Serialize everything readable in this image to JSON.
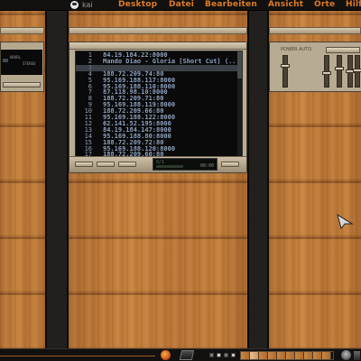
{
  "topbar": {
    "user_name": "kai",
    "menu": [
      "Desktop",
      "Datei",
      "Bearbeiten",
      "Ansicht",
      "Orte",
      "Hilfe"
    ]
  },
  "playlist": {
    "entries": [
      {
        "num": "1",
        "text": "84.19.184.22:8000"
      },
      {
        "num": "2",
        "text": "Mando Diao - Gloria [Short Cut] (..."
      },
      {
        "num": "3",
        "text": ""
      },
      {
        "num": "4",
        "text": "188.72.209.74:80"
      },
      {
        "num": "5",
        "text": "95.169.188.117:8000"
      },
      {
        "num": "6",
        "text": "95.169.188.110:8000"
      },
      {
        "num": "7",
        "text": "87.118.98.10:8000"
      },
      {
        "num": "8",
        "text": "188.72.209.71:80"
      },
      {
        "num": "9",
        "text": "95.169.188.119:8000"
      },
      {
        "num": "10",
        "text": "188.72.209.66:80"
      },
      {
        "num": "11",
        "text": "95.169.188.122:8000"
      },
      {
        "num": "12",
        "text": "62.141.52.195:8000"
      },
      {
        "num": "13",
        "text": "84.19.184.147:8000"
      },
      {
        "num": "14",
        "text": "95.169.188.80:8000"
      },
      {
        "num": "15",
        "text": "188.72.209.72:80"
      },
      {
        "num": "16",
        "text": "95.169.188.120:8000"
      },
      {
        "num": "17",
        "text": "188.72.209.60:80"
      }
    ],
    "selected_index": 2,
    "info_text": "0/1",
    "time_text": "00:00"
  },
  "mini_player": {
    "lines": [
      "HRVRL",
      "STEREO"
    ]
  },
  "equalizer": {
    "label": "POWER AUTO",
    "levels": [
      0.3,
      0.55,
      0.4,
      0.5,
      0.45
    ]
  },
  "colors": {
    "menu_text": "#e07c26",
    "playlist_text": "#8da2bf",
    "playlist_bg": "#0a0a0a",
    "wood": "#c3803c"
  },
  "icons": [
    "user-icon",
    "firefox-icon",
    "terminal-icon",
    "trash-icon",
    "mouse-cursor-icon"
  ]
}
